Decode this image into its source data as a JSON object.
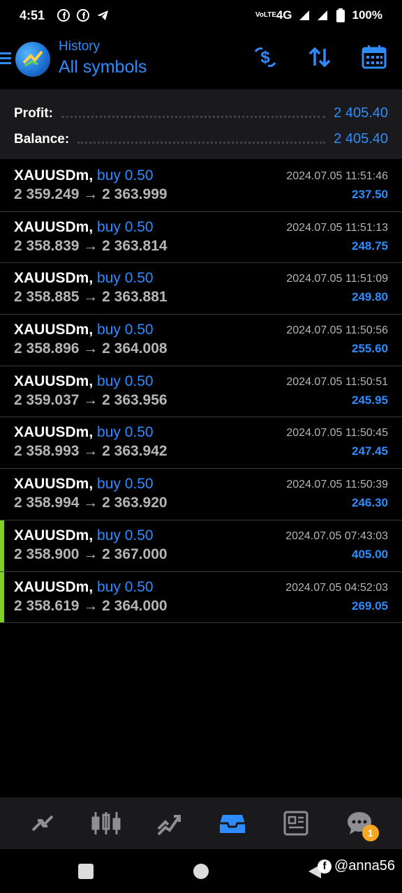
{
  "status_bar": {
    "time": "4:51",
    "network": "4G",
    "volte": "VoLTE",
    "battery": "100%"
  },
  "header": {
    "subtitle": "History",
    "title": "All symbols"
  },
  "summary": {
    "profit_label": "Profit:",
    "profit_value": "2 405.40",
    "balance_label": "Balance:",
    "balance_value": "2 405.40"
  },
  "deals": [
    {
      "symbol": "XAUUSDm,",
      "direction": "buy 0.50",
      "open": "2 359.249",
      "close": "2 363.999",
      "time": "2024.07.05 11:51:46",
      "profit": "237.50"
    },
    {
      "symbol": "XAUUSDm,",
      "direction": "buy 0.50",
      "open": "2 358.839",
      "close": "2 363.814",
      "time": "2024.07.05 11:51:13",
      "profit": "248.75"
    },
    {
      "symbol": "XAUUSDm,",
      "direction": "buy 0.50",
      "open": "2 358.885",
      "close": "2 363.881",
      "time": "2024.07.05 11:51:09",
      "profit": "249.80"
    },
    {
      "symbol": "XAUUSDm,",
      "direction": "buy 0.50",
      "open": "2 358.896",
      "close": "2 364.008",
      "time": "2024.07.05 11:50:56",
      "profit": "255.60"
    },
    {
      "symbol": "XAUUSDm,",
      "direction": "buy 0.50",
      "open": "2 359.037",
      "close": "2 363.956",
      "time": "2024.07.05 11:50:51",
      "profit": "245.95"
    },
    {
      "symbol": "XAUUSDm,",
      "direction": "buy 0.50",
      "open": "2 358.993",
      "close": "2 363.942",
      "time": "2024.07.05 11:50:45",
      "profit": "247.45"
    },
    {
      "symbol": "XAUUSDm,",
      "direction": "buy 0.50",
      "open": "2 358.994",
      "close": "2 363.920",
      "time": "2024.07.05 11:50:39",
      "profit": "246.30"
    },
    {
      "symbol": "XAUUSDm,",
      "direction": "buy 0.50",
      "open": "2 358.900",
      "close": "2 367.000",
      "time": "2024.07.05 07:43:03",
      "profit": "405.00"
    },
    {
      "symbol": "XAUUSDm,",
      "direction": "buy 0.50",
      "open": "2 358.619",
      "close": "2 364.000",
      "time": "2024.07.05 04:52:03",
      "profit": "269.05"
    }
  ],
  "arrow": "→",
  "bottom_nav": {
    "items": [
      "quotes-icon",
      "chart-icon",
      "trade-icon",
      "history-icon",
      "news-icon",
      "messages-icon"
    ],
    "messages_badge": "1"
  },
  "watermark": "@anna56",
  "colors": {
    "accent": "#2f8cff",
    "marker": "#7ed321",
    "badge": "#f5a623"
  }
}
